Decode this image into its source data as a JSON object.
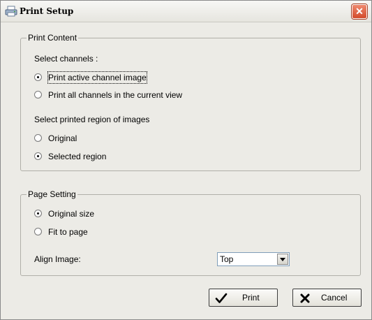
{
  "window": {
    "title": "Print Setup",
    "close_glyph": "✕"
  },
  "print_content": {
    "legend": "Print Content",
    "select_channels_label": "Select channels :",
    "channel_options": [
      {
        "label": "Print active channel image",
        "checked": true
      },
      {
        "label": "Print all channels in the current view",
        "checked": false
      }
    ],
    "region_label": "Select printed region of images",
    "region_options": [
      {
        "label": "Original",
        "checked": false
      },
      {
        "label": "Selected region",
        "checked": true
      }
    ]
  },
  "page_setting": {
    "legend": "Page Setting",
    "size_options": [
      {
        "label": "Original size",
        "checked": true
      },
      {
        "label": "Fit to page",
        "checked": false
      }
    ],
    "align_label": "Align Image:",
    "align_value": "Top"
  },
  "buttons": {
    "print_label": "Print",
    "cancel_label": "Cancel"
  },
  "icons": {
    "app": "printer-icon",
    "close": "close-icon",
    "print": "checkmark-icon",
    "cancel": "x-icon",
    "dropdown": "chevron-down-icon"
  },
  "colors": {
    "window_bg": "#ecebe6",
    "close_red": "#d24a2a",
    "field_border": "#7f9db9"
  }
}
